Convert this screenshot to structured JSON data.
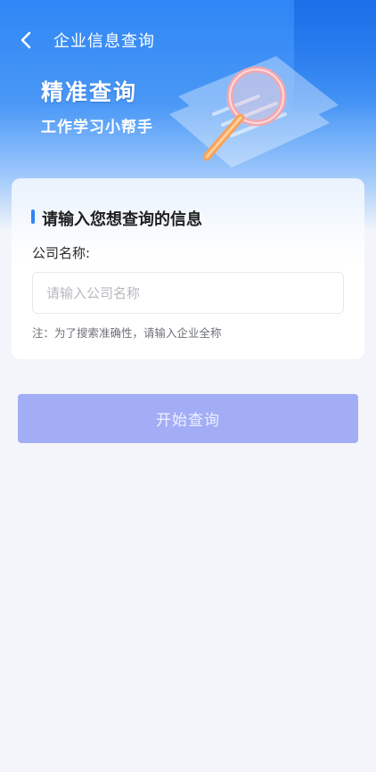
{
  "header": {
    "title": "企业信息查询",
    "back_icon": "chevron-left-icon"
  },
  "hero": {
    "title": "精准查询",
    "subtitle": "工作学习小帮手",
    "illustration_icon": "magnifier-icon"
  },
  "form": {
    "section_title": "请输入您想查询的信息",
    "company_label": "公司名称:",
    "company_placeholder": "请输入公司名称",
    "company_value": "",
    "note": "注：为了搜索准确性，请输入企业全称"
  },
  "actions": {
    "submit_label": "开始查询"
  },
  "colors": {
    "primary": "#2f86f5",
    "button_disabled": "#a3adf6",
    "background": "#f3f5fa"
  }
}
